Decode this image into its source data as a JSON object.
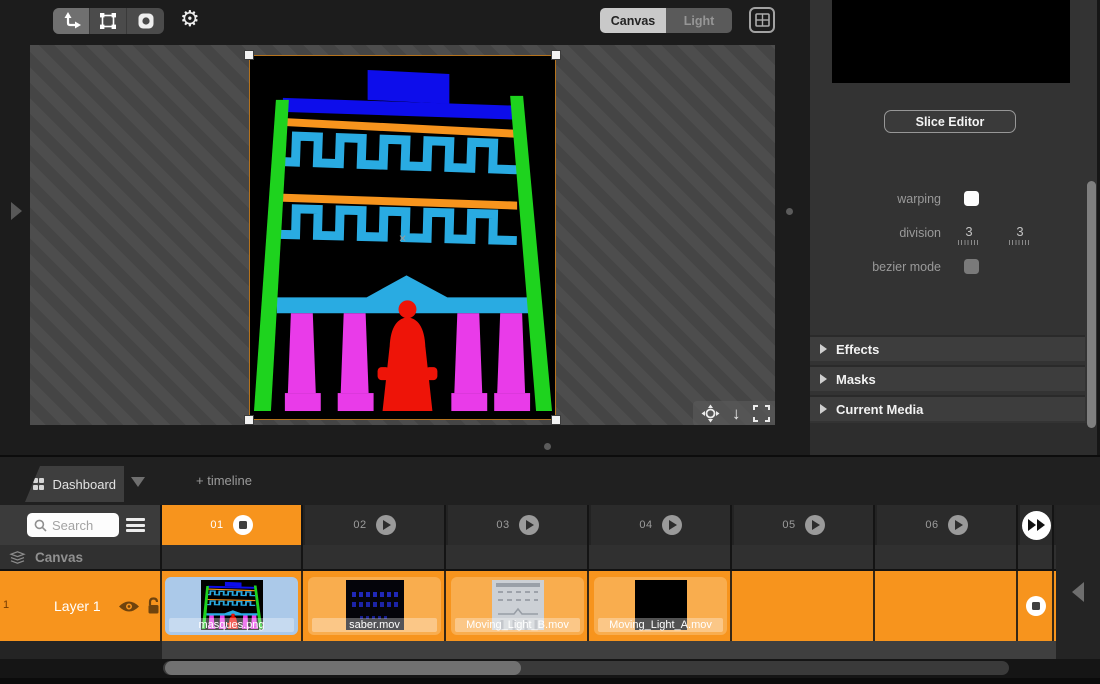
{
  "top_toolbar": {
    "tools": [
      {
        "id": "move-transform-tool",
        "icon": "move-arrows-icon",
        "active": true
      },
      {
        "id": "quad-warp-tool",
        "icon": "quad-corners-icon",
        "active": false
      },
      {
        "id": "output-mask-tool",
        "icon": "rounded-mask-icon",
        "active": false
      }
    ],
    "settings_icon": "gear-icon",
    "gear_glyph": "⚙",
    "view_mode_toggle": {
      "options": [
        {
          "label": "Canvas",
          "active": true
        },
        {
          "label": "Light",
          "active": false
        }
      ]
    },
    "layout_grid_icon": "grid-2x2-icon"
  },
  "canvas_viewport": {
    "selected_media_name": "masques.png",
    "center_marker": "×",
    "overlay_controls": [
      {
        "icon": "center-view-icon"
      },
      {
        "icon": "arrow-down-icon",
        "glyph": "↓"
      },
      {
        "icon": "fit-fullscreen-icon"
      }
    ]
  },
  "right_panel": {
    "slice_editor_button": "Slice Editor",
    "warping_label": "warping",
    "warping_checked": true,
    "division_label": "division",
    "division_values": [
      "3",
      "3"
    ],
    "bezier_label": "bezier mode",
    "bezier_checked": false,
    "sections": [
      {
        "label": "Effects"
      },
      {
        "label": "Masks"
      },
      {
        "label": "Current Media"
      }
    ]
  },
  "bottom_panel": {
    "dashboard_tab": "Dashboard",
    "timeline_tab": "+ timeline",
    "search_placeholder": "Search",
    "scenes": [
      {
        "label": "01",
        "control": "stop",
        "active": true
      },
      {
        "label": "02",
        "control": "play",
        "active": false
      },
      {
        "label": "03",
        "control": "play",
        "active": false
      },
      {
        "label": "04",
        "control": "play",
        "active": false
      },
      {
        "label": "05",
        "control": "play",
        "active": false
      },
      {
        "label": "06",
        "control": "play",
        "active": false
      }
    ],
    "canvas_row_label": "Canvas",
    "layer": {
      "index": "1",
      "name": "Layer 1",
      "cells": [
        {
          "media": "masques.png",
          "selected": true
        },
        {
          "media": "saber.mov",
          "selected": false
        },
        {
          "media": "Moving_Light_B.mov",
          "selected": false
        },
        {
          "media": "Moving_Light_A.mov",
          "selected": false
        },
        {
          "media": "",
          "selected": false
        },
        {
          "media": "",
          "selected": false
        }
      ]
    }
  },
  "colors": {
    "accent_orange": "#f7941d",
    "selection_blue": "#abc9e9",
    "cell_orange": "#f9ad4e"
  }
}
